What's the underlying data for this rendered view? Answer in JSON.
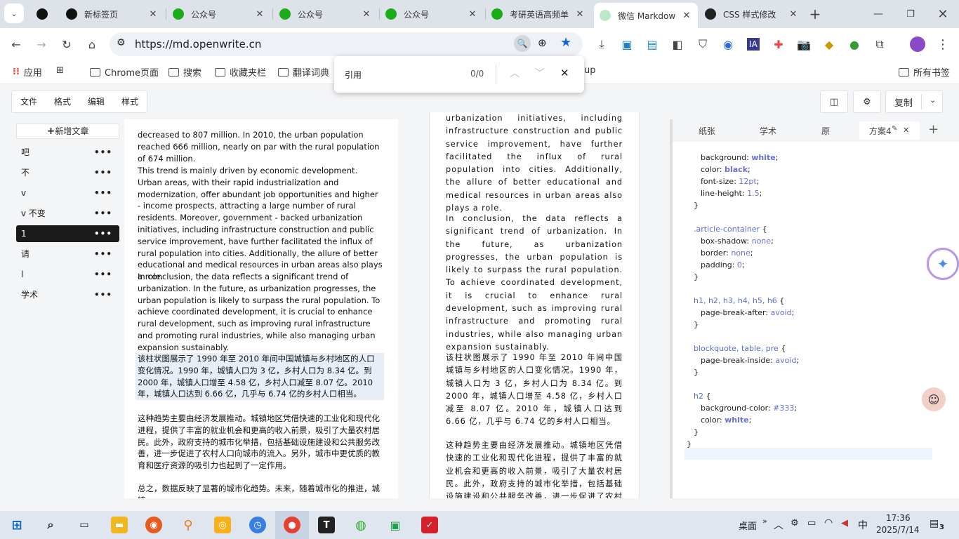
{
  "browser": {
    "tabs": [
      {
        "title": "",
        "icon": "infinity-icon"
      },
      {
        "title": "新标签页",
        "icon": "infinity-icon"
      },
      {
        "title": "公众号",
        "icon": "wechat-mp-icon"
      },
      {
        "title": "公众号",
        "icon": "wechat-mp-icon"
      },
      {
        "title": "公众号",
        "icon": "wechat-mp-icon"
      },
      {
        "title": "考研英语高频单",
        "icon": "wechat-icon"
      },
      {
        "title": "微信 Markdow",
        "icon": "openwrite-icon"
      },
      {
        "title": "CSS 样式修改",
        "icon": "chatgpt-icon"
      }
    ],
    "url": "https://md.openwrite.cn",
    "bookmarks": [
      {
        "label": "应用"
      },
      {
        "label": "Chrome页面"
      },
      {
        "label": "搜索"
      },
      {
        "label": "收藏夹栏"
      },
      {
        "label": "翻译词典"
      },
      {
        "label": "up"
      },
      {
        "label": "所有书签"
      }
    ],
    "find": {
      "query": "引用",
      "count": "0/0"
    }
  },
  "app": {
    "menu": [
      "文件",
      "格式",
      "编辑",
      "样式"
    ],
    "copy_label": "复制",
    "new_doc_label": "新增文章",
    "docs": [
      "吧",
      "不",
      "v",
      "v 不变",
      "1",
      "请",
      "l",
      "学术"
    ],
    "selected_doc": 4,
    "editor_paragraphs": [
      "decreased to 807 million. In 2010, the urban population reached 666 million, nearly on par with the rural population of 674 million.",
      "This trend is mainly driven by economic development. Urban areas, with their rapid industrialization and modernization, offer abundant job opportunities and higher - income prospects, attracting a large number of rural residents. Moreover, government - backed urbanization initiatives, including infrastructure construction and public service improvement, have further facilitated the influx of rural population into cities. Additionally, the allure of better educational and medical resources in urban areas also plays a role.",
      "In conclusion, the data reflects a significant trend of urbanization. In the future, as urbanization progresses, the urban population is likely to surpass the rural population. To achieve coordinated development, it is crucial to enhance rural development, such as improving rural infrastructure and promoting rural industries, while also managing urban expansion sustainably.",
      "该柱状图展示了 1990 年至 2010 年间中国城镇与乡村地区的人口变化情况。1990 年，城镇人口为 3 亿，乡村人口为 8.34 亿。到 2000 年，城镇人口增至 4.58 亿，乡村人口减至 8.07 亿。2010 年，城镇人口达到 6.66 亿，几乎与 6.74 亿的乡村人口相当。",
      "这种趋势主要由经济发展推动。城镇地区凭借快速的工业化和现代化进程，提供了丰富的就业机会和更高的收入前景，吸引了大量农村居民。此外，政府支持的城市化举措，包括基础设施建设和公共服务改善，进一步促进了农村人口向城市的流入。另外，城市中更优质的教育和医疗资源的吸引力也起到了一定作用。",
      "总之，数据反映了显著的城市化趋势。未来，随着城市化的推进，城镇"
    ],
    "preview_paragraphs": [
      "urbanization initiatives, including infrastructure construction and public service improvement, have further facilitated the influx of rural population into cities. Additionally, the allure of better educational and medical resources in urban areas also plays a role.",
      "In conclusion, the data reflects a significant trend of urbanization. In the future, as urbanization progresses, the urban population is likely to surpass the rural population. To achieve coordinated development, it is crucial to enhance rural development, such as improving rural infrastructure and promoting rural industries, while also managing urban expansion sustainably.",
      "该柱状图展示了 1990 年至 2010 年间中国城镇与乡村地区的人口变化情况。1990 年，城镇人口为 3 亿，乡村人口为 8.34 亿。到 2000 年，城镇人口增至 4.58 亿，乡村人口减至 8.07 亿。2010 年，城镇人口达到 6.66 亿，几乎与 6.74 亿的乡村人口相当。",
      "这种趋势主要由经济发展推动。城镇地区凭借快速的工业化和现代化进程，提供了丰富的就业机会和更高的收入前景，吸引了大量农村居民。此外，政府支持的城市化举措，包括基础设施建设和公共服务改善，进一步促进了农村人口向城市的流入。另"
    ],
    "css_tabs": [
      "纸张",
      "学术",
      "原",
      "方案4"
    ],
    "css_code": [
      {
        "indent": 1,
        "prop": "background",
        "val": "white"
      },
      {
        "indent": 1,
        "prop": "color",
        "val": "black"
      },
      {
        "indent": 1,
        "prop": "font-size",
        "val": "12pt"
      },
      {
        "indent": 1,
        "prop": "line-height",
        "val": "1.5"
      },
      {
        "indent": 0,
        "text": "}"
      },
      {
        "indent": 0,
        "text": ""
      },
      {
        "indent": 0,
        "sel": ".article-container",
        "text": " {"
      },
      {
        "indent": 1,
        "prop": "box-shadow",
        "val": "none"
      },
      {
        "indent": 1,
        "prop": "border",
        "val": "none"
      },
      {
        "indent": 1,
        "prop": "padding",
        "val": "0"
      },
      {
        "indent": 0,
        "text": "}"
      },
      {
        "indent": 0,
        "text": ""
      },
      {
        "indent": 0,
        "sel": "h1, h2, h3, h4, h5, h6",
        "text": " {"
      },
      {
        "indent": 1,
        "prop": "page-break-after",
        "val": "avoid"
      },
      {
        "indent": 0,
        "text": "}"
      },
      {
        "indent": 0,
        "text": ""
      },
      {
        "indent": 0,
        "sel": "blockquote, table, pre",
        "text": " {"
      },
      {
        "indent": 1,
        "prop": "page-break-inside",
        "val": "avoid"
      },
      {
        "indent": 0,
        "text": "}"
      },
      {
        "indent": 0,
        "text": ""
      },
      {
        "indent": 0,
        "sel": "h2",
        "text": " {"
      },
      {
        "indent": 1,
        "prop": "background-color",
        "val": "#333"
      },
      {
        "indent": 1,
        "prop": "color",
        "val": "white"
      },
      {
        "indent": 0,
        "text": "}"
      },
      {
        "indent": -1,
        "text": "}"
      }
    ]
  },
  "taskbar": {
    "desktop_label": "桌面",
    "ime": "中",
    "time": "17:36",
    "date": "2025/7/14",
    "notifications": "3"
  }
}
